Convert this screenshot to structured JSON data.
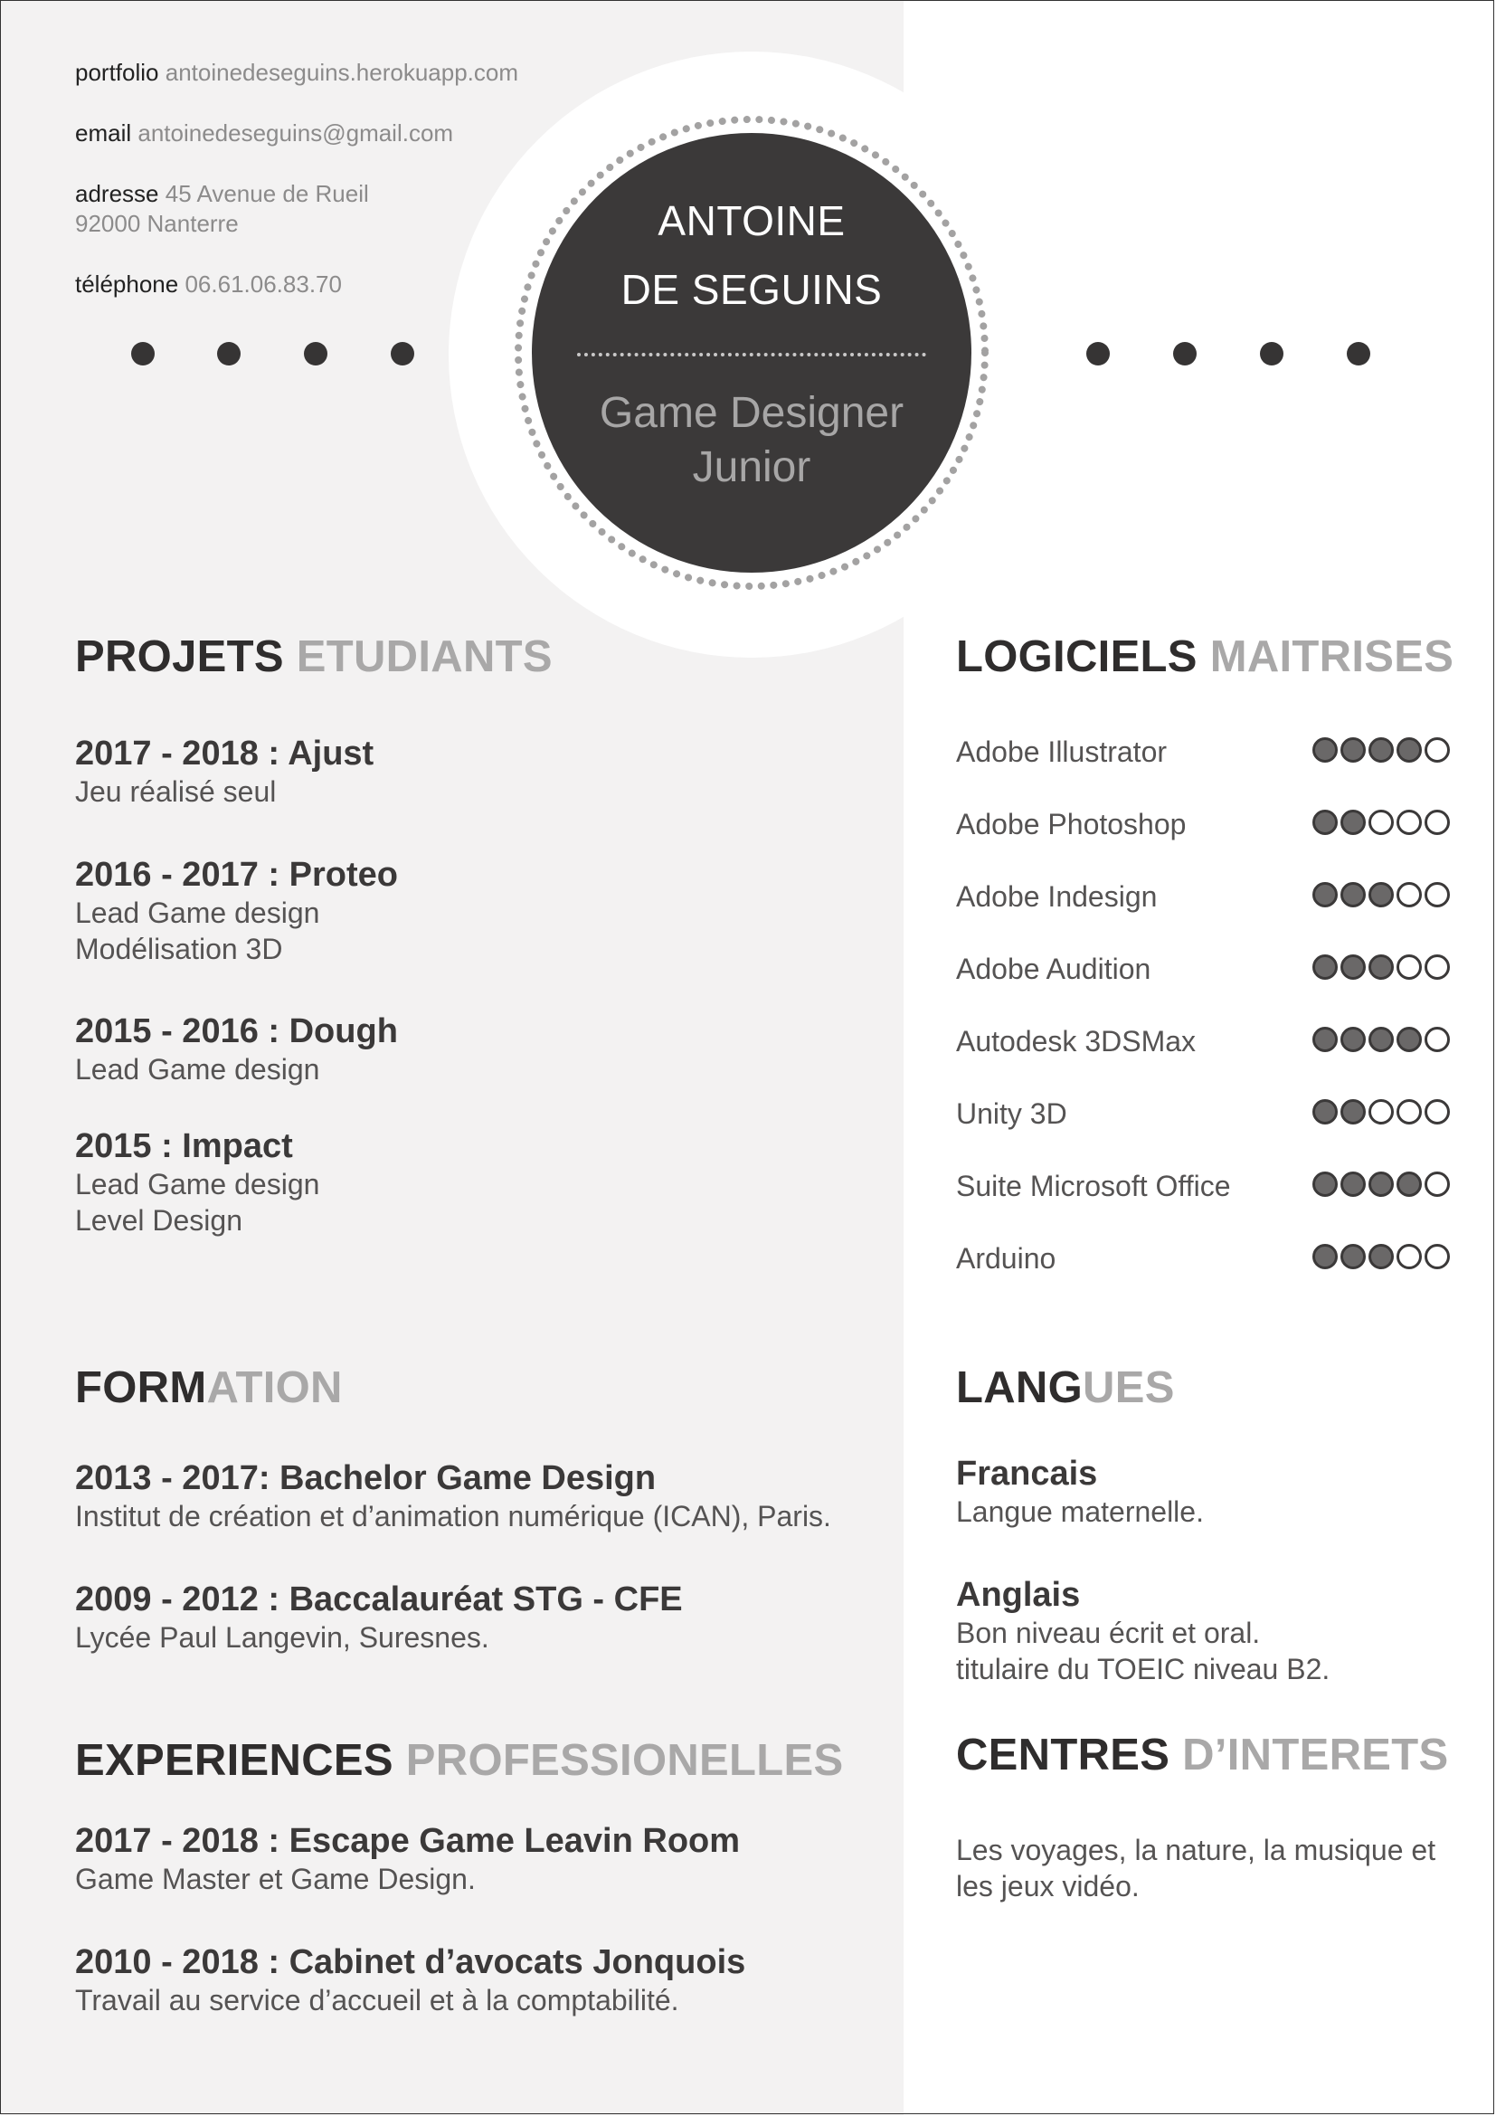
{
  "contact": {
    "portfolio_label": "portfolio",
    "portfolio_value": "antoinedeseguins.herokuapp.com",
    "email_label": "email",
    "email_value": "antoinedeseguins@gmail.com",
    "address_label": "adresse",
    "address_line1": "45 Avenue de Rueil",
    "address_line2": "92000 Nanterre",
    "phone_label": "téléphone",
    "phone_value": "06.61.06.83.70"
  },
  "badge": {
    "name_line1": "ANTOINE",
    "name_line2": "DE SEGUINS",
    "role_line1": "Game Designer",
    "role_line2": "Junior"
  },
  "projects": {
    "heading_dark": "PROJETS",
    "heading_light": "ETUDIANTS",
    "items": [
      {
        "title": "2017 - 2018 : Ajust",
        "lines": [
          "Jeu réalisé seul"
        ]
      },
      {
        "title": "2016 - 2017 : Proteo",
        "lines": [
          "Lead Game design",
          "Modélisation 3D"
        ]
      },
      {
        "title": "2015 - 2016 : Dough",
        "lines": [
          "Lead Game design"
        ]
      },
      {
        "title": "2015 : Impact",
        "lines": [
          "Lead Game design",
          "Level Design"
        ]
      }
    ]
  },
  "formation": {
    "heading_dark": "FORM",
    "heading_light": "ATION",
    "items": [
      {
        "title": "2013 - 2017: Bachelor Game Design",
        "lines": [
          "Institut de création et d’animation numérique (ICAN), Paris."
        ]
      },
      {
        "title": "2009 - 2012 : Baccalauréat STG - CFE",
        "lines": [
          "Lycée Paul Langevin, Suresnes."
        ]
      }
    ]
  },
  "experiences": {
    "heading_dark": "EXPERIENCES",
    "heading_light": "PROFESSIONELLES",
    "items": [
      {
        "title": "2017 - 2018 : Escape Game Leavin Room",
        "lines": [
          "Game Master et Game Design."
        ]
      },
      {
        "title": "2010 - 2018 : Cabinet d’avocats Jonquois",
        "lines": [
          "Travail au service d’accueil et à la comptabilité."
        ]
      }
    ]
  },
  "software": {
    "heading_dark": "LOGICIELS",
    "heading_light": "MAITRISES",
    "items": [
      {
        "name": "Adobe Illustrator",
        "level": 4,
        "max": 5
      },
      {
        "name": "Adobe Photoshop",
        "level": 2,
        "max": 5
      },
      {
        "name": "Adobe Indesign",
        "level": 3,
        "max": 5
      },
      {
        "name": "Adobe Audition",
        "level": 3,
        "max": 5
      },
      {
        "name": "Autodesk 3DSMax",
        "level": 4,
        "max": 5
      },
      {
        "name": "Unity 3D",
        "level": 2,
        "max": 5
      },
      {
        "name": "Suite Microsoft Office",
        "level": 4,
        "max": 5
      },
      {
        "name": "Arduino",
        "level": 3,
        "max": 5
      }
    ]
  },
  "languages": {
    "heading_dark": "LANG",
    "heading_light": "UES",
    "items": [
      {
        "title": "Francais",
        "lines": [
          "Langue maternelle."
        ]
      },
      {
        "title": "Anglais",
        "lines": [
          "Bon niveau écrit et oral.",
          "titulaire du TOEIC niveau B2."
        ]
      }
    ]
  },
  "interests": {
    "heading_dark": "CENTRES",
    "heading_light": "D’INTERETS",
    "lines": [
      "Les voyages, la nature, la musique et",
      "les jeux vidéo."
    ]
  }
}
